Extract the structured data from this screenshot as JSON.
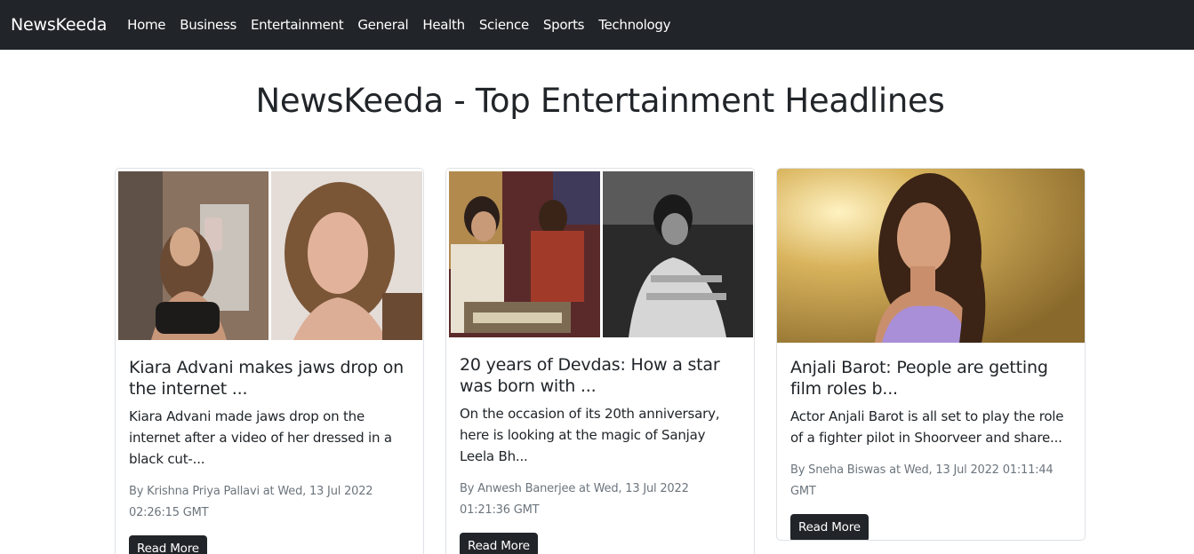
{
  "nav": {
    "brand": "NewsKeeda",
    "items": [
      {
        "label": "Home"
      },
      {
        "label": "Business"
      },
      {
        "label": "Entertainment"
      },
      {
        "label": "General"
      },
      {
        "label": "Health"
      },
      {
        "label": "Science"
      },
      {
        "label": "Sports"
      },
      {
        "label": "Technology"
      }
    ]
  },
  "page": {
    "title": "NewsKeeda - Top Entertainment Headlines"
  },
  "cards": [
    {
      "title": "Kiara Advani makes jaws drop on the internet ...",
      "description": "Kiara Advani made jaws drop on the internet after a video of her dressed in a black cut-...",
      "meta": "By Krishna Priya Pallavi at Wed, 13 Jul 2022 02:26:15 GMT",
      "button": "Read More"
    },
    {
      "title": "20 years of Devdas: How a star was born with ...",
      "description": "On the occasion of its 20th anniversary, here is looking at the magic of Sanjay Leela Bh...",
      "meta": "By Anwesh Banerjee at Wed, 13 Jul 2022 01:21:36 GMT",
      "button": "Read More"
    },
    {
      "title": "Anjali Barot: People are getting film roles b...",
      "description": "Actor Anjali Barot is all set to play the role of a fighter pilot in Shoorveer and share...",
      "meta": "By Sneha Biswas at Wed, 13 Jul 2022 01:11:44 GMT",
      "button": "Read More"
    }
  ],
  "colors": {
    "navbar": "#212529",
    "text": "#212529",
    "muted": "#6c757d",
    "button": "#212529"
  }
}
